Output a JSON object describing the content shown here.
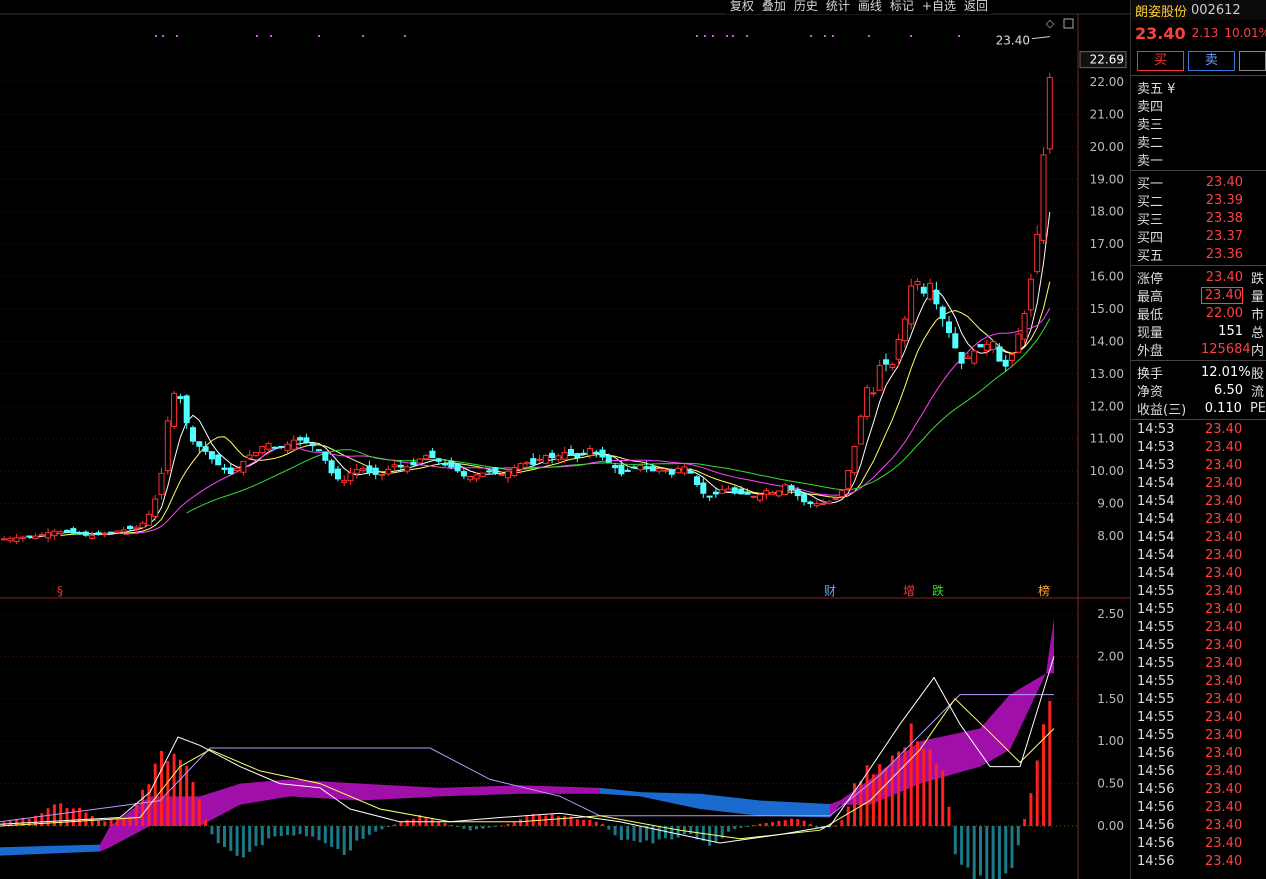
{
  "menu": [
    "复权",
    "叠加",
    "历史",
    "统计",
    "画线",
    "标记",
    "+自选",
    "返回"
  ],
  "stock": {
    "name": "朗姿股份",
    "code": "002612",
    "last": "23.40",
    "change": "2.13",
    "pct": "10.01%"
  },
  "buttons": {
    "buy": "买",
    "sell": "卖",
    "blank": ""
  },
  "ask_rows": [
    {
      "label": "卖五 ¥",
      "price": ""
    },
    {
      "label": "卖四",
      "price": ""
    },
    {
      "label": "卖三",
      "price": ""
    },
    {
      "label": "卖二",
      "price": ""
    },
    {
      "label": "卖一",
      "price": ""
    }
  ],
  "bid_rows": [
    {
      "label": "买一",
      "price": "23.40"
    },
    {
      "label": "买二",
      "price": "23.39"
    },
    {
      "label": "买三",
      "price": "23.38"
    },
    {
      "label": "买四",
      "price": "23.37"
    },
    {
      "label": "买五",
      "price": "23.36"
    }
  ],
  "stats1": [
    {
      "label": "涨停",
      "value": "23.40",
      "side": "跌"
    },
    {
      "label": "最高",
      "value": "23.40",
      "side": "量"
    },
    {
      "label": "最低",
      "value": "22.00",
      "side": "市"
    },
    {
      "label": "现量",
      "value": "151",
      "side": "总"
    },
    {
      "label": "外盘",
      "value": "125684",
      "side": "内"
    }
  ],
  "stats2": [
    {
      "label": "换手",
      "value": "12.01%",
      "side": "股"
    },
    {
      "label": "净资",
      "value": "6.50",
      "side": "流"
    },
    {
      "label": "收益(三)",
      "value": "0.110",
      "side": "PE"
    }
  ],
  "ticks": [
    {
      "time": "14:53",
      "price": "23.40"
    },
    {
      "time": "14:53",
      "price": "23.40"
    },
    {
      "time": "14:53",
      "price": "23.40"
    },
    {
      "time": "14:54",
      "price": "23.40"
    },
    {
      "time": "14:54",
      "price": "23.40"
    },
    {
      "time": "14:54",
      "price": "23.40"
    },
    {
      "time": "14:54",
      "price": "23.40"
    },
    {
      "time": "14:54",
      "price": "23.40"
    },
    {
      "time": "14:54",
      "price": "23.40"
    },
    {
      "time": "14:55",
      "price": "23.40"
    },
    {
      "time": "14:55",
      "price": "23.40"
    },
    {
      "time": "14:55",
      "price": "23.40"
    },
    {
      "time": "14:55",
      "price": "23.40"
    },
    {
      "time": "14:55",
      "price": "23.40"
    },
    {
      "time": "14:55",
      "price": "23.40"
    },
    {
      "time": "14:55",
      "price": "23.40"
    },
    {
      "time": "14:55",
      "price": "23.40"
    },
    {
      "time": "14:55",
      "price": "23.40"
    },
    {
      "time": "14:56",
      "price": "23.40"
    },
    {
      "time": "14:56",
      "price": "23.40"
    },
    {
      "time": "14:56",
      "price": "23.40"
    },
    {
      "time": "14:56",
      "price": "23.40"
    },
    {
      "time": "14:56",
      "price": "23.40"
    },
    {
      "time": "14:56",
      "price": "23.40"
    },
    {
      "time": "14:56",
      "price": "23.40"
    }
  ],
  "chart_data": {
    "type": "candlestick",
    "last_price_label": "23.40",
    "current_price_tag": "22.69",
    "price_ticks": [
      22,
      21,
      20,
      19,
      18,
      17,
      16,
      15,
      14,
      13,
      12,
      11,
      10,
      9,
      8
    ],
    "indicator_ticks": [
      2.5,
      2.0,
      1.5,
      1.0,
      0.5,
      0.0
    ],
    "event_markers": [
      "§",
      "财",
      "增",
      "跌",
      "榜"
    ],
    "colors": {
      "up": "#ff3030",
      "down": "#54ffff",
      "ma5": "#ffffff",
      "ma10": "#ffff66",
      "ma20": "#ff44ff",
      "ma30": "#33dd33"
    }
  }
}
